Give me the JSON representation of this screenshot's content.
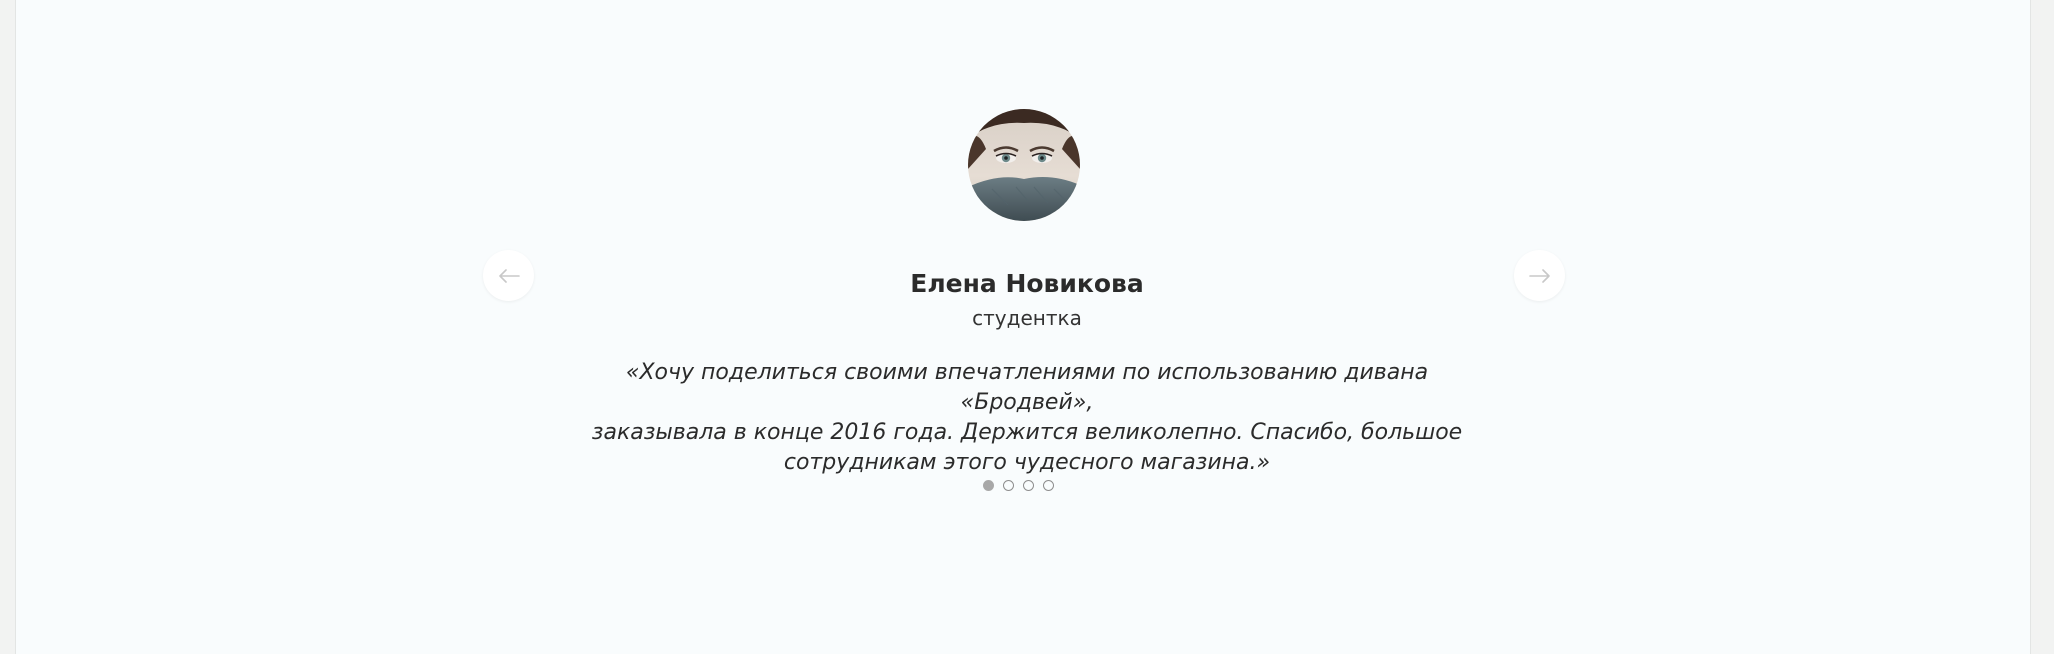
{
  "testimonial": {
    "name": "Елена Новикова",
    "role": "студентка",
    "quote_line1": "«Хочу поделиться своими впечатлениями по использованию дивана «Бродвей»,",
    "quote_line2": "заказывала в конце 2016 года. Держится великолепно. Спасибо, большое",
    "quote_line3": "сотрудникам этого чудесного магазина.»"
  },
  "navigation": {
    "prev_icon": "arrow-left-icon",
    "next_icon": "arrow-right-icon"
  },
  "pagination": {
    "total": 4,
    "active_index": 0
  },
  "colors": {
    "background": "#f9fcfd",
    "outer": "#f2f3f2",
    "text": "#2b2b2b",
    "arrow": "#c8c8c8",
    "dot_active": "#a8a8a8"
  }
}
